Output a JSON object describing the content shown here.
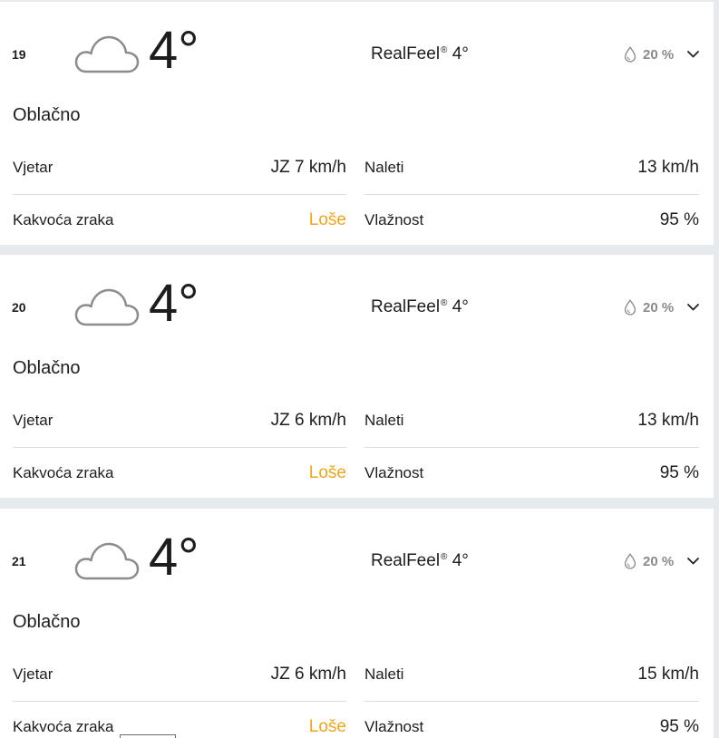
{
  "colors": {
    "page_background": "#e6eaed",
    "card_background": "#ffffff",
    "text_primary": "#1d1d1d",
    "text_muted": "#8a8a8a",
    "air_quality_poor": "#f2a516",
    "divider": "#dddddd",
    "icon_stroke": "#8c8c8c"
  },
  "icons": {
    "precipitation": "raindrop-icon",
    "expand": "chevron-down-icon"
  },
  "hours": [
    {
      "hour": "19",
      "icon": "cloud-icon",
      "temperature": "4°",
      "realfeel": {
        "label": "RealFeel",
        "mark": "®",
        "value": "4°"
      },
      "precip_probability": "20 %",
      "condition": "Oblačno",
      "details": [
        {
          "label": "Vjetar",
          "value": "JZ 7 km/h"
        },
        {
          "label": "Naleti",
          "value": "13 km/h"
        },
        {
          "label": "Kakvoća zraka",
          "value": "Loše"
        },
        {
          "label": "Vlažnost",
          "value": "95 %"
        }
      ]
    },
    {
      "hour": "20",
      "icon": "cloud-icon",
      "temperature": "4°",
      "realfeel": {
        "label": "RealFeel",
        "mark": "®",
        "value": "4°"
      },
      "precip_probability": "20 %",
      "condition": "Oblačno",
      "details": [
        {
          "label": "Vjetar",
          "value": "JZ 6 km/h"
        },
        {
          "label": "Naleti",
          "value": "13 km/h"
        },
        {
          "label": "Kakvoća zraka",
          "value": "Loše"
        },
        {
          "label": "Vlažnost",
          "value": "95 %"
        }
      ]
    },
    {
      "hour": "21",
      "icon": "cloud-icon",
      "temperature": "4°",
      "realfeel": {
        "label": "RealFeel",
        "mark": "®",
        "value": "4°"
      },
      "precip_probability": "20 %",
      "condition": "Oblačno",
      "details": [
        {
          "label": "Vjetar",
          "value": "JZ 6 km/h"
        },
        {
          "label": "Naleti",
          "value": "15 km/h"
        },
        {
          "label": "Kakvoća zraka",
          "value": "Loše"
        },
        {
          "label": "Vlažnost",
          "value": "95 %"
        }
      ]
    }
  ]
}
